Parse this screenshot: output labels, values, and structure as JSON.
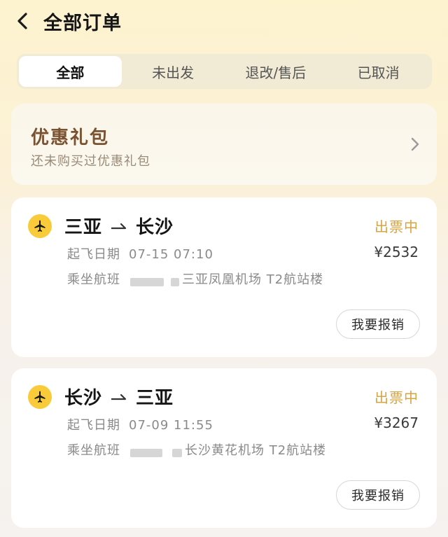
{
  "header": {
    "title": "全部订单"
  },
  "tabs": [
    {
      "label": "全部",
      "active": true
    },
    {
      "label": "未出发",
      "active": false
    },
    {
      "label": "退改/售后",
      "active": false
    },
    {
      "label": "已取消",
      "active": false
    }
  ],
  "promo": {
    "title": "优惠礼包",
    "subtitle": "还未购买过优惠礼包"
  },
  "orders": [
    {
      "from": "三亚",
      "to": "长沙",
      "status": "出票中",
      "date_label": "起飞日期",
      "date_value": "07-15 07:10",
      "price": "¥2532",
      "flight_label": "乘坐航班",
      "airport": "三亚凤凰机场 T2航站楼",
      "action": "我要报销"
    },
    {
      "from": "长沙",
      "to": "三亚",
      "status": "出票中",
      "date_label": "起飞日期",
      "date_value": "07-09 11:55",
      "price": "¥3267",
      "flight_label": "乘坐航班",
      "airport": "长沙黄花机场 T2航站楼",
      "action": "我要报销"
    }
  ],
  "colors": {
    "accent": "#f9cb3a",
    "status": "#d9a441",
    "promo_title": "#7a5231"
  },
  "icons": {
    "back": "chevron-left-icon",
    "plane": "airplane-icon",
    "promo": "chevron-right-icon"
  }
}
